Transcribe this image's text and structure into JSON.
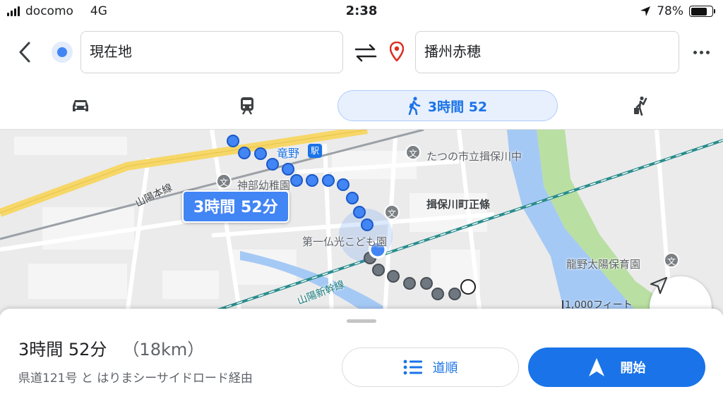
{
  "status_bar": {
    "carrier": "docomo",
    "network": "4G",
    "time": "2:38",
    "battery_percent": "78%",
    "battery_level": 0.78
  },
  "search": {
    "origin": "現在地",
    "destination": "播州赤穂",
    "back_icon": "chevron-left-icon",
    "swap_icon": "swap-arrows-icon",
    "more_icon": "more-dots-icon"
  },
  "travel_modes": {
    "drive_icon": "car-icon",
    "transit_icon": "train-icon",
    "walk_label": "3時間 52",
    "walk_icon": "walking-icon",
    "ride_icon": "rideshare-icon",
    "selected": "walk"
  },
  "map": {
    "route_callout": "3時間 52分",
    "labels": {
      "station": "竜野",
      "school_1": "たつの市立揖保川中",
      "kindergarten": "神部幼稚園",
      "district": "揖保川町正條",
      "nursery_1": "第一仏光こども園",
      "nursery_2": "龍野太陽保育園",
      "line_1": "山陽本線",
      "line_2": "山陽新幹線"
    },
    "poi_glyph": "文",
    "station_glyph": "駅",
    "scale": "1,000フィート",
    "recenter_icon": "navigation-arrow-icon",
    "colors": {
      "route_blue": "#4285f4",
      "route_gray": "#6f7780",
      "river": "#a5c9f5",
      "park": "#b9dfa2",
      "highway": "#f6d768"
    }
  },
  "sheet": {
    "duration": "3時間 52分",
    "distance": "（18km）",
    "via": "県道121号 と はりまシーサイドロード経由",
    "steps_label": "道順",
    "start_label": "開始"
  }
}
